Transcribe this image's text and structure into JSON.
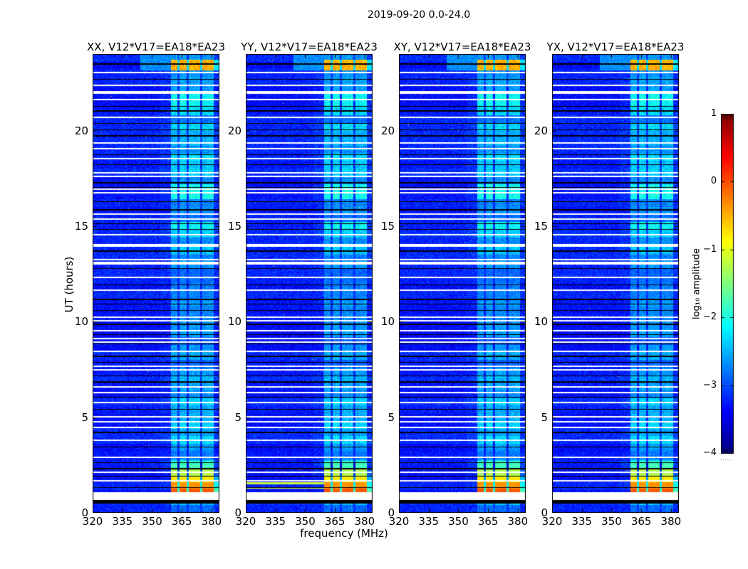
{
  "chart_data": {
    "type": "heatmap",
    "title": "2019-09-20 0.0-24.0",
    "xlabel": "frequency (MHz)",
    "ylabel": "UT (hours)",
    "x_range": [
      320,
      384
    ],
    "y_range": [
      0,
      24
    ],
    "x_tick_values": [
      320,
      335,
      350,
      365,
      380
    ],
    "y_tick_values": [
      0,
      5,
      10,
      15,
      20
    ],
    "panels": [
      {
        "key": "xx",
        "title": "XX, V12*V17=EA18*EA23",
        "seed": 101
      },
      {
        "key": "yy",
        "title": "YY, V12*V17=EA18*EA23",
        "seed": 202,
        "full_width_rows": [
          {
            "t": 1.55,
            "level": -1.1
          },
          {
            "t": 1.3,
            "level": -0.9
          }
        ]
      },
      {
        "key": "xy",
        "title": "XY, V12*V17=EA18*EA23",
        "seed": 303
      },
      {
        "key": "yx",
        "title": "YX, V12*V17=EA18*EA23",
        "seed": 404
      }
    ],
    "colorbar": {
      "label": "log₁₀ amplitude",
      "range": [
        -4,
        1
      ],
      "tick_values": [
        1,
        0,
        -1,
        -2,
        -3,
        -4
      ],
      "tick_labels": [
        "1",
        "0",
        "−1",
        "−2",
        "−3",
        "−4"
      ],
      "colormap": "jet"
    },
    "features": {
      "background_level_range": [
        -3.55,
        -3.0
      ],
      "rfi_band": {
        "freq_start": 359.5,
        "freq_end": 381.3,
        "channel_gaps": [
          363.4,
          368.0,
          374.7
        ],
        "gap_width": 1.1,
        "faint_left_edge": 354,
        "panel_right_edge": 384
      },
      "band_time_envelope": [
        [
          0,
          0.48,
          0.55
        ],
        [
          0.48,
          1.08,
          0
        ],
        [
          1.08,
          2.7,
          0.85
        ],
        [
          2.7,
          3.3,
          0.5
        ],
        [
          3.3,
          8,
          0.6
        ],
        [
          8,
          13.5,
          0.45
        ],
        [
          13.5,
          23.2,
          0.75
        ],
        [
          23.2,
          24,
          0.65
        ]
      ],
      "events": [
        {
          "t0": 23.15,
          "t1": 23.72,
          "level": -0.5,
          "jitter": 0.28
        },
        {
          "t0": 2.35,
          "t1": 2.65,
          "level": -1.8,
          "jitter": 0.2
        },
        {
          "t0": 1.95,
          "t1": 2.35,
          "level": -1.25,
          "jitter": 0.2
        },
        {
          "t0": 1.6,
          "t1": 1.95,
          "level": -0.8,
          "jitter": 0.18
        },
        {
          "t0": 1.28,
          "t1": 1.6,
          "level": -0.35,
          "jitter": 0.15
        },
        {
          "t0": 1.08,
          "t1": 1.28,
          "level": -0.05,
          "jitter": 0.12
        }
      ],
      "top_shoulder": {
        "t0": 23.15,
        "freq0": 344,
        "freq1": 359.5,
        "level": -2.9
      },
      "white_gap": [
        0.67,
        1.08
      ],
      "black_band": [
        0.48,
        0.67
      ],
      "white_lines": [
        23.06,
        22.4,
        21.65,
        20.72,
        19.4,
        19.07,
        18.57,
        17.83,
        17.64,
        16.96,
        16.77,
        15.65,
        15.4,
        14.6,
        14.05,
        13.98,
        13.3,
        12.37,
        11.7,
        10.26,
        10.08,
        9.58,
        9.15,
        8.96,
        8.5,
        7.72,
        7.5,
        6.62,
        6.33,
        5.8,
        5.06,
        4.8,
        4.5,
        3.82,
        2.95,
        2.14,
        1.71
      ],
      "thick_white_lines": [
        22.02,
        13.08
      ],
      "black_lines": [
        23.52,
        22.7,
        21.3,
        21.05,
        20.4,
        20.07,
        19.75,
        18.77,
        18.25,
        17.3,
        17.05,
        16.3,
        15.9,
        15.15,
        14.85,
        13.73,
        12.8,
        11.94,
        11.2,
        10.94,
        10.6,
        9.89,
        9.33,
        8.84,
        8.22,
        7.9,
        7.2,
        6.9,
        6.05,
        5.43,
        4.25,
        3.45,
        2.64,
        2.33,
        1.95,
        1.34
      ]
    }
  },
  "colors": {
    "background": "#ffffff",
    "frame": "#000000",
    "gap_white": "#ffffff",
    "line_black": "#000000"
  }
}
